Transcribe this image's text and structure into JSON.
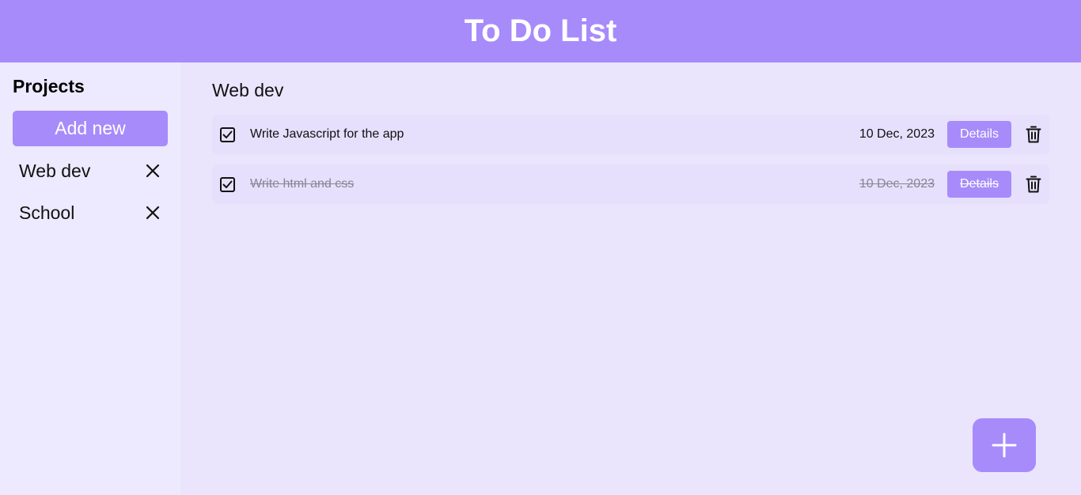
{
  "app": {
    "title": "To Do List"
  },
  "sidebar": {
    "title": "Projects",
    "add_new_label": "Add new",
    "projects": [
      {
        "label": "Web dev"
      },
      {
        "label": "School"
      }
    ]
  },
  "main": {
    "project_title": "Web dev",
    "tasks": [
      {
        "title": "Write Javascript for the app",
        "date": "10 Dec, 2023",
        "details_label": "Details",
        "completed": false,
        "checked": true
      },
      {
        "title": "Write html and css",
        "date": "10 Dec, 2023",
        "details_label": "Details",
        "completed": true,
        "checked": true
      }
    ]
  },
  "icons": {
    "close": "close-icon",
    "checkbox": "checkbox-checked-icon",
    "trash": "trash-icon",
    "add": "plus-icon"
  },
  "colors": {
    "accent": "#a78bfa",
    "background": "#eae5fd",
    "sidebar": "#ede9fe",
    "task_row": "#e6e0fd"
  }
}
